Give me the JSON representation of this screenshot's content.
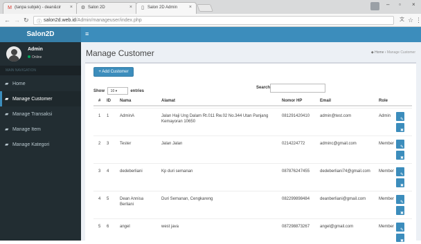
{
  "browser": {
    "tabs": [
      {
        "label": "(tanpa subjek) - dean&cir",
        "icon": "gmail-icon"
      },
      {
        "label": "Salon 2D",
        "icon": "settings-icon"
      },
      {
        "label": "Salon 2D Admin",
        "icon": "page-icon"
      }
    ],
    "url_domain": "salon2d.web.id",
    "url_path": "/Admin/manageuser/index.php"
  },
  "app": {
    "brand": "Salon2D"
  },
  "user": {
    "name": "Admin",
    "status": "Online"
  },
  "sidebar": {
    "section": "MAIN NAVIGATION",
    "items": [
      {
        "label": "Home"
      },
      {
        "label": "Manage Customer"
      },
      {
        "label": "Manage Transaksi"
      },
      {
        "label": "Manage Item"
      },
      {
        "label": "Manage Kategori"
      }
    ]
  },
  "page": {
    "title": "Manage Customer",
    "breadcrumb_home": "Home",
    "breadcrumb_current": "Manage Customer",
    "add_label": "+ Add Customer",
    "show_label": "Show",
    "show_value": "10",
    "entries_label": "entries",
    "search_label": "Search:"
  },
  "table": {
    "headers": [
      "#",
      "ID",
      "Nama",
      "Alamat",
      "Nomor HP",
      "Email",
      "Role"
    ],
    "rows": [
      {
        "no": "1",
        "id": "1",
        "nama": "AdminA",
        "alamat": "Jalan Haji Ung Dalam Rt.011 Rw.02 No.344 Utan Panjang Kemayoran 10650",
        "hp": "081291420410",
        "email": "admin@test.com",
        "role": "Admin"
      },
      {
        "no": "2",
        "id": "3",
        "nama": "Tester",
        "alamat": "Jalan Jalan",
        "hp": "0214224772",
        "email": "adminc@gmail.com",
        "role": "Member"
      },
      {
        "no": "3",
        "id": "4",
        "nama": "dedeberliani",
        "alamat": "Kp duri semanan",
        "hp": "087876247455",
        "email": "dedeberliani74@gmail.com",
        "role": "Member"
      },
      {
        "no": "4",
        "id": "5",
        "nama": "Dean Annisa Berliani",
        "alamat": "Duri Semanan, Cengkareng",
        "hp": "082299898484",
        "email": "deanberliani@gmail.com",
        "role": "Member"
      },
      {
        "no": "5",
        "id": "6",
        "nama": "angel",
        "alamat": "west java",
        "hp": "087298873267",
        "email": "angel@gmail.com",
        "role": "Member"
      }
    ]
  }
}
